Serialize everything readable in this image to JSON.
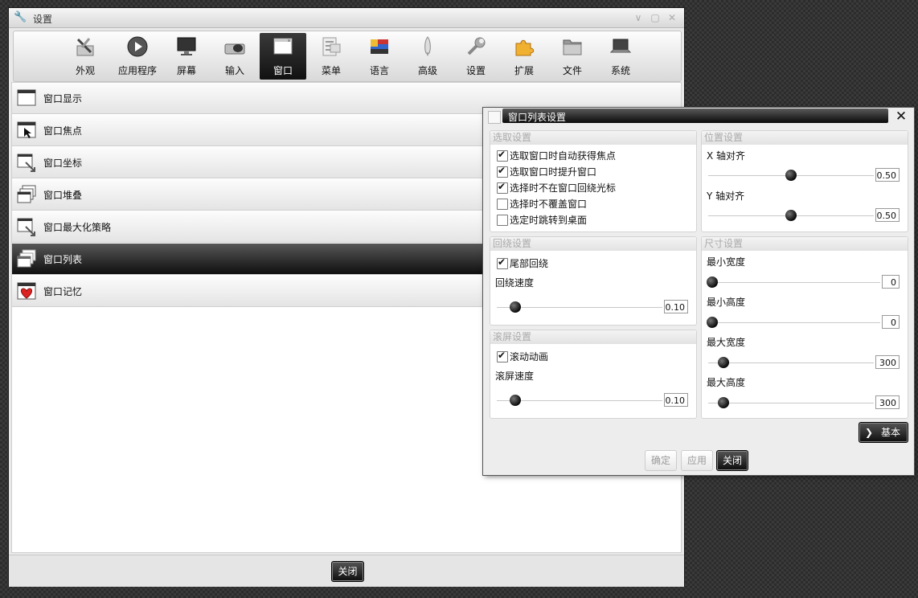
{
  "window": {
    "title": "设置"
  },
  "toolbar": {
    "items": [
      {
        "label": "外观",
        "icon": "appearance-icon"
      },
      {
        "label": "应用程序",
        "icon": "applications-icon"
      },
      {
        "label": "屏幕",
        "icon": "screen-icon"
      },
      {
        "label": "输入",
        "icon": "input-icon"
      },
      {
        "label": "窗口",
        "icon": "window-icon"
      },
      {
        "label": "菜单",
        "icon": "menu-icon"
      },
      {
        "label": "语言",
        "icon": "language-icon"
      },
      {
        "label": "高级",
        "icon": "advanced-icon"
      },
      {
        "label": "设置",
        "icon": "settings-icon"
      },
      {
        "label": "扩展",
        "icon": "extensions-icon"
      },
      {
        "label": "文件",
        "icon": "files-icon"
      },
      {
        "label": "系统",
        "icon": "system-icon"
      }
    ],
    "active_index": 4
  },
  "list": {
    "items": [
      {
        "label": "窗口显示",
        "icon": "window-display-icon"
      },
      {
        "label": "窗口焦点",
        "icon": "window-focus-icon"
      },
      {
        "label": "窗口坐标",
        "icon": "window-geometry-icon"
      },
      {
        "label": "窗口堆叠",
        "icon": "window-stacking-icon"
      },
      {
        "label": "窗口最大化策略",
        "icon": "window-maximize-policy-icon"
      },
      {
        "label": "窗口列表",
        "icon": "window-list-icon"
      },
      {
        "label": "窗口记忆",
        "icon": "window-remember-icon"
      }
    ],
    "selected_index": 5
  },
  "footer": {
    "close_label": "关闭"
  },
  "dialog": {
    "title": "窗口列表设置",
    "selection": {
      "title": "选取设置",
      "options": [
        {
          "label": "选取窗口时自动获得焦点",
          "checked": true
        },
        {
          "label": "选取窗口时提升窗口",
          "checked": true
        },
        {
          "label": "选择时不在窗口回绕光标",
          "checked": true
        },
        {
          "label": "选择时不覆盖窗口",
          "checked": false
        },
        {
          "label": "选定时跳转到桌面",
          "checked": false
        }
      ]
    },
    "position": {
      "title": "位置设置",
      "x_label": "X 轴对齐",
      "x_value": "0.50",
      "y_label": "Y 轴对齐",
      "y_value": "0.50"
    },
    "wrap": {
      "title": "回绕设置",
      "tail_label": "尾部回绕",
      "tail_checked": true,
      "speed_label": "回绕速度",
      "speed_value": "0.10"
    },
    "size": {
      "title": "尺寸设置",
      "min_w_label": "最小宽度",
      "min_w_value": "0",
      "min_h_label": "最小高度",
      "min_h_value": "0",
      "max_w_label": "最大宽度",
      "max_w_value": "300",
      "max_h_label": "最大高度",
      "max_h_value": "300"
    },
    "scroll": {
      "title": "滚屏设置",
      "anim_label": "滚动动画",
      "anim_checked": true,
      "speed_label": "滚屏速度",
      "speed_value": "0.10"
    },
    "basic_label": "基本",
    "ok_label": "确定",
    "apply_label": "应用",
    "close_label": "关闭"
  }
}
